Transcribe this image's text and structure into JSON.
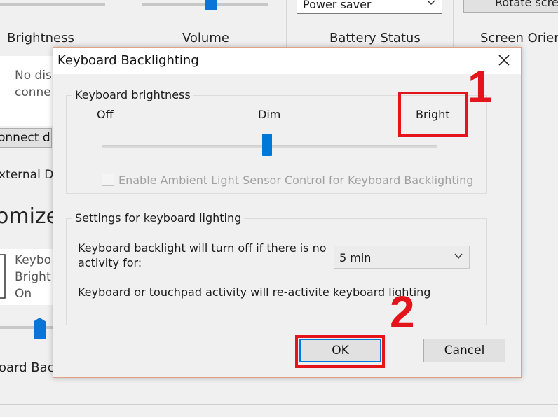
{
  "background": {
    "tiles": {
      "brightness_label": "Brightness",
      "volume_label": "Volume",
      "battery_label": "Battery Status",
      "battery_select_value": "Power saver",
      "screen_label": "Screen Orient",
      "rotate_button": "Rotate scre"
    },
    "display_tile": {
      "line1": "No dis",
      "line2": "conne",
      "connect_button": "onnect d",
      "external_label": "xternal D"
    },
    "customize_heading": "omize",
    "keyboard_tile": {
      "line1": "Keybo",
      "line2": "Bright",
      "line3": "On",
      "label": "oard Bac"
    }
  },
  "dialog": {
    "title": "Keyboard Backlighting",
    "close_icon": "close-icon",
    "brightness_group": {
      "title": "Keyboard brightness",
      "levels": [
        "Off",
        "Dim",
        "Bright"
      ],
      "selected_level": "Dim",
      "slider_level_fraction": 0.5,
      "ambient_checkbox_label": "Enable Ambient Light Sensor Control for Keyboard Backlighting",
      "ambient_checked": false
    },
    "lighting_group": {
      "title": "Settings for keyboard lighting",
      "timeout_label_line1": "Keyboard backlight will turn off if there is no",
      "timeout_label_line2": "activity for:",
      "timeout_value": "5 min",
      "reactivate_text": "Keyboard or touchpad activity will re-activite keyboard lighting"
    },
    "buttons": {
      "ok": "OK",
      "cancel": "Cancel"
    }
  },
  "annotations": {
    "step1": "1",
    "step2": "2",
    "color": "#e3151a"
  },
  "colors": {
    "accent": "#0078d7"
  }
}
